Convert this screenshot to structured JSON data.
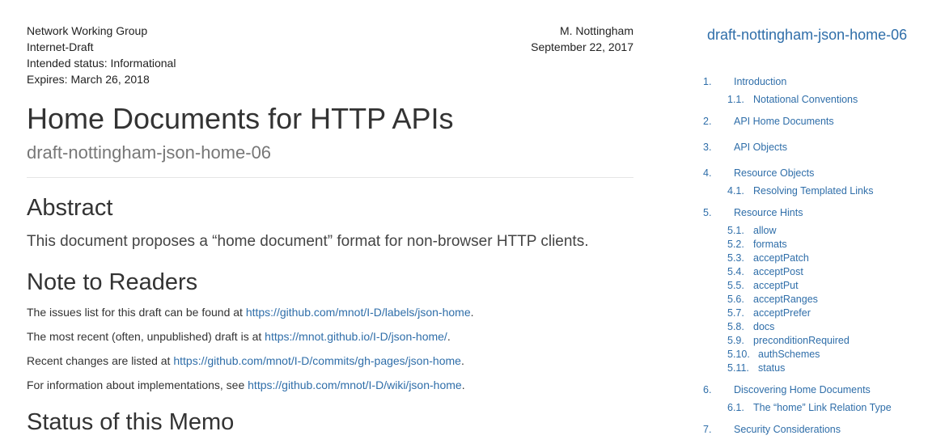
{
  "header": {
    "left": [
      "Network Working Group",
      "Internet-Draft",
      "Intended status: Informational",
      "Expires: March 26, 2018"
    ],
    "right": [
      "M. Nottingham",
      "September 22, 2017"
    ]
  },
  "title": "Home Documents for HTTP APIs",
  "subtitle": "draft-nottingham-json-home-06",
  "abstract": {
    "heading": "Abstract",
    "text": "This document proposes a “home document” format for non-browser HTTP clients."
  },
  "note": {
    "heading": "Note to Readers",
    "paragraphs": [
      {
        "prefix": "The issues list for this draft can be found at ",
        "link": "https://github.com/mnot/I-D/labels/json-home",
        "suffix": "."
      },
      {
        "prefix": "The most recent (often, unpublished) draft is at ",
        "link": "https://mnot.github.io/I-D/json-home/",
        "suffix": "."
      },
      {
        "prefix": "Recent changes are listed at ",
        "link": "https://github.com/mnot/I-D/commits/gh-pages/json-home",
        "suffix": "."
      },
      {
        "prefix": "For information about implementations, see ",
        "link": "https://github.com/mnot/I-D/wiki/json-home",
        "suffix": "."
      }
    ]
  },
  "status_heading": "Status of this Memo",
  "toc": {
    "title": "draft-nottingham-json-home-06",
    "items": [
      {
        "num": "1.",
        "label": "Introduction"
      },
      {
        "num": "1.1.",
        "label": "Notational Conventions"
      },
      {
        "num": "2.",
        "label": "API Home Documents"
      },
      {
        "num": "3.",
        "label": "API Objects"
      },
      {
        "num": "4.",
        "label": "Resource Objects"
      },
      {
        "num": "4.1.",
        "label": "Resolving Templated Links"
      },
      {
        "num": "5.",
        "label": "Resource Hints"
      },
      {
        "num": "5.1.",
        "label": "allow"
      },
      {
        "num": "5.2.",
        "label": "formats"
      },
      {
        "num": "5.3.",
        "label": "acceptPatch"
      },
      {
        "num": "5.4.",
        "label": "acceptPost"
      },
      {
        "num": "5.5.",
        "label": "acceptPut"
      },
      {
        "num": "5.6.",
        "label": "acceptRanges"
      },
      {
        "num": "5.7.",
        "label": "acceptPrefer"
      },
      {
        "num": "5.8.",
        "label": "docs"
      },
      {
        "num": "5.9.",
        "label": "preconditionRequired"
      },
      {
        "num": "5.10.",
        "label": "authSchemes"
      },
      {
        "num": "5.11.",
        "label": "status"
      },
      {
        "num": "6.",
        "label": "Discovering Home Documents"
      },
      {
        "num": "6.1.",
        "label": "The “home” Link Relation Type"
      },
      {
        "num": "7.",
        "label": "Security Considerations"
      }
    ]
  }
}
